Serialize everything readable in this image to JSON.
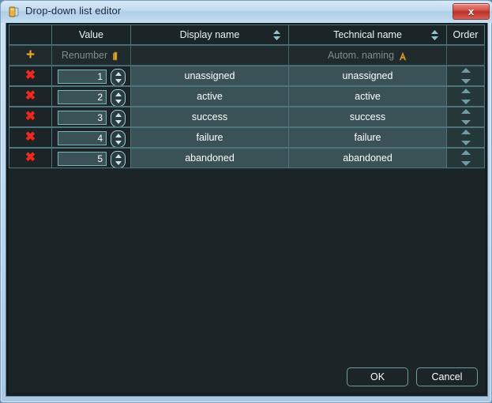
{
  "window": {
    "title": "Drop-down list editor",
    "icon": "list-editor-icon",
    "close_label": "x"
  },
  "table": {
    "headers": {
      "delete": "",
      "value": "Value",
      "display_name": "Display name",
      "technical_name": "Technical name",
      "order": "Order"
    },
    "action_row": {
      "add_label": "+",
      "renumber_label": "Renumber",
      "renumber_icon": "number-one-icon",
      "auto_naming_label": "Autom. naming",
      "auto_naming_icon": "letter-a-icon",
      "order_label": ""
    },
    "rows": [
      {
        "delete_label": "✖",
        "value": "1",
        "display_name": "unassigned",
        "technical_name": "unassigned"
      },
      {
        "delete_label": "✖",
        "value": "2",
        "display_name": "active",
        "technical_name": "active"
      },
      {
        "delete_label": "✖",
        "value": "3",
        "display_name": "success",
        "technical_name": "success"
      },
      {
        "delete_label": "✖",
        "value": "4",
        "display_name": "failure",
        "technical_name": "failure"
      },
      {
        "delete_label": "✖",
        "value": "5",
        "display_name": "abandoned",
        "technical_name": "abandoned"
      }
    ]
  },
  "footer": {
    "ok_label": "OK",
    "cancel_label": "Cancel"
  },
  "colors": {
    "accent_gold": "#f0a82a",
    "delete_red": "#e82a20",
    "cell_teal": "#3a5256",
    "panel_dark": "#1b2427",
    "border_teal": "#4e757b",
    "titlebar_blue": "#c2dbef",
    "close_red": "#bd2f26"
  }
}
